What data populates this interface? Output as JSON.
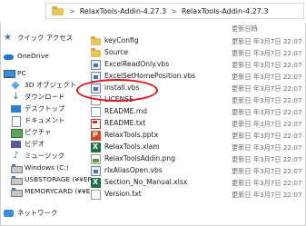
{
  "address": {
    "crumbs": [
      "RelaxTools-Addin-4.27.3",
      "RelaxTools-Addin-4.27.3"
    ],
    "separator": ">"
  },
  "columns": {
    "date": "更新日時"
  },
  "nav": [
    {
      "label": "クイック アクセス",
      "icon": "star-icon"
    },
    {
      "label": "OneDrive",
      "icon": "cloud-icon"
    },
    {
      "label": "PC",
      "icon": "computer-icon"
    },
    {
      "label": "3D オブジェクト",
      "icon": "cube-icon"
    },
    {
      "label": "ダウンロード",
      "icon": "download-icon"
    },
    {
      "label": "デスクトップ",
      "icon": "desktop-icon"
    },
    {
      "label": "ドキュメント",
      "icon": "document-icon"
    },
    {
      "label": "ピクチャ",
      "icon": "picture-icon"
    },
    {
      "label": "ビデオ",
      "icon": "video-icon"
    },
    {
      "label": "ミュージック",
      "icon": "music-icon"
    },
    {
      "label": "Windows (C:)",
      "icon": "drive-icon"
    },
    {
      "label": "USBSTORAGE (¥¥EP",
      "icon": "drive-icon"
    },
    {
      "label": "MEMORYCARD (¥¥E",
      "icon": "drive-icon"
    },
    {
      "label": "ネットワーク",
      "icon": "network-icon"
    }
  ],
  "files": [
    {
      "name": "keyConfig",
      "date": "更新日 年3月7日 22:07",
      "icon": "folder-icon"
    },
    {
      "name": "Source",
      "date": "更新日 年3月7日 22:07",
      "icon": "folder-icon"
    },
    {
      "name": "ExcelReadOnly.vbs",
      "date": "更新日 年3月7日 22:07",
      "icon": "vbs-icon"
    },
    {
      "name": "ExcelSetHomePosition.vbs",
      "date": "更新日 年3月7日 22:07",
      "icon": "vbs-icon"
    },
    {
      "name": "install.vbs",
      "date": "更新日 年3月7日 22:07",
      "icon": "vbs-icon"
    },
    {
      "name": "LICENSE",
      "date": "更新日 年3月7日 22:07",
      "icon": "document-icon"
    },
    {
      "name": "README.md",
      "date": "更新日 年3月7日 22:07",
      "icon": "document-icon"
    },
    {
      "name": "README.txt",
      "date": "更新日 年3月7日 22:07",
      "icon": "document-icon"
    },
    {
      "name": "RelaxTools.pptx",
      "date": "更新日 年3月7日 22:07",
      "icon": "powerpoint-icon"
    },
    {
      "name": "RelaxTools.xlam",
      "date": "更新日 年3月7日 22:07",
      "icon": "excel-icon"
    },
    {
      "name": "RelaxToolsAddin.png",
      "date": "更新日 年3月7日 22:07",
      "icon": "image-icon"
    },
    {
      "name": "rlxAliasOpen.vbs",
      "date": "更新日 年3月7日 22:07",
      "icon": "vbs-icon"
    },
    {
      "name": "Section_No_Manual.xlsx",
      "date": "更新日 年3月7日 22:07",
      "icon": "excel-icon"
    },
    {
      "name": "Version.txt",
      "date": "更新日 年3月7日 22:07",
      "icon": "document-icon"
    }
  ],
  "annotation": {
    "color": "#e0161b",
    "target": "install.vbs"
  }
}
